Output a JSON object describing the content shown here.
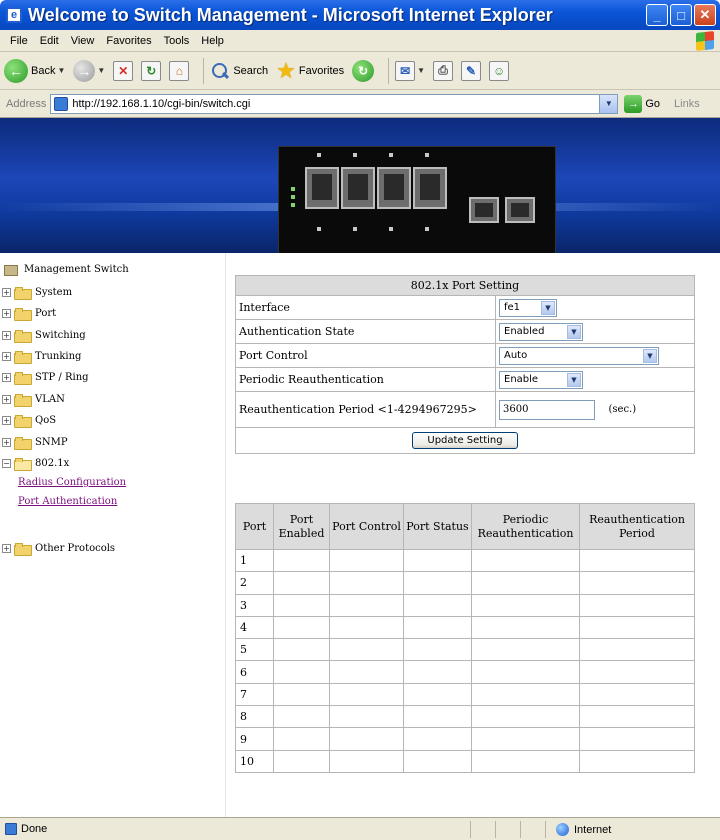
{
  "window": {
    "title": "Welcome to Switch Management - Microsoft Internet Explorer",
    "app_icon_glyph": "e",
    "minimize_glyph": "_",
    "maximize_glyph": "□",
    "close_glyph": "✕"
  },
  "menu": {
    "items": [
      "File",
      "Edit",
      "View",
      "Favorites",
      "Tools",
      "Help"
    ]
  },
  "toolbar": {
    "back_label": "Back",
    "search_label": "Search",
    "favorites_label": "Favorites"
  },
  "address": {
    "label": "Address",
    "url": "http://192.168.1.10/cgi-bin/switch.cgi",
    "go_label": "Go",
    "links_label": "Links"
  },
  "tree": {
    "root_label": "Management Switch",
    "items": [
      {
        "label": "System",
        "icon": "folder-icon",
        "toggle": "+"
      },
      {
        "label": "Port",
        "icon": "folder-icon",
        "toggle": "+"
      },
      {
        "label": "Switching",
        "icon": "folder-icon",
        "toggle": "+"
      },
      {
        "label": "Trunking",
        "icon": "folder-icon",
        "toggle": "+"
      },
      {
        "label": "STP / Ring",
        "icon": "folder-icon",
        "toggle": "+"
      },
      {
        "label": "VLAN",
        "icon": "folder-icon",
        "toggle": "+"
      },
      {
        "label": "QoS",
        "icon": "folder-icon",
        "toggle": "+"
      },
      {
        "label": "SNMP",
        "icon": "folder-icon",
        "toggle": "+"
      },
      {
        "label": "802.1x",
        "icon": "folder-open-icon",
        "toggle": "−"
      },
      {
        "label": "Other Protocols",
        "icon": "folder-icon",
        "toggle": "+"
      }
    ],
    "sublinks": [
      "Radius Configuration",
      "Port Authentication"
    ]
  },
  "settings": {
    "header": "802.1x Port Setting",
    "interface_label": "Interface",
    "interface_value": "fe1",
    "auth_state_label": "Authentication State",
    "auth_state_value": "Enabled",
    "port_control_label": "Port Control",
    "port_control_value": "Auto",
    "periodic_label": "Periodic Reauthentication",
    "periodic_value": "Enable",
    "period_label": "Reauthentication Period <1-4294967295>",
    "period_value": "3600",
    "period_unit": "(sec.)",
    "update_button": "Update Setting"
  },
  "status_table": {
    "headers": [
      "Port",
      "Port Enabled",
      "Port Control",
      "Port Status",
      "Periodic Reauthentication",
      "Reauthentication Period"
    ],
    "rows": [
      "1",
      "2",
      "3",
      "4",
      "5",
      "6",
      "7",
      "8",
      "9",
      "10"
    ]
  },
  "statusbar": {
    "text": "Done",
    "zone": "Internet"
  },
  "colors": {
    "titlebar": "#0a55d8",
    "chrome": "#ece9d8",
    "table_header": "#dcdcdc",
    "link_visited": "#7a0f7a"
  }
}
